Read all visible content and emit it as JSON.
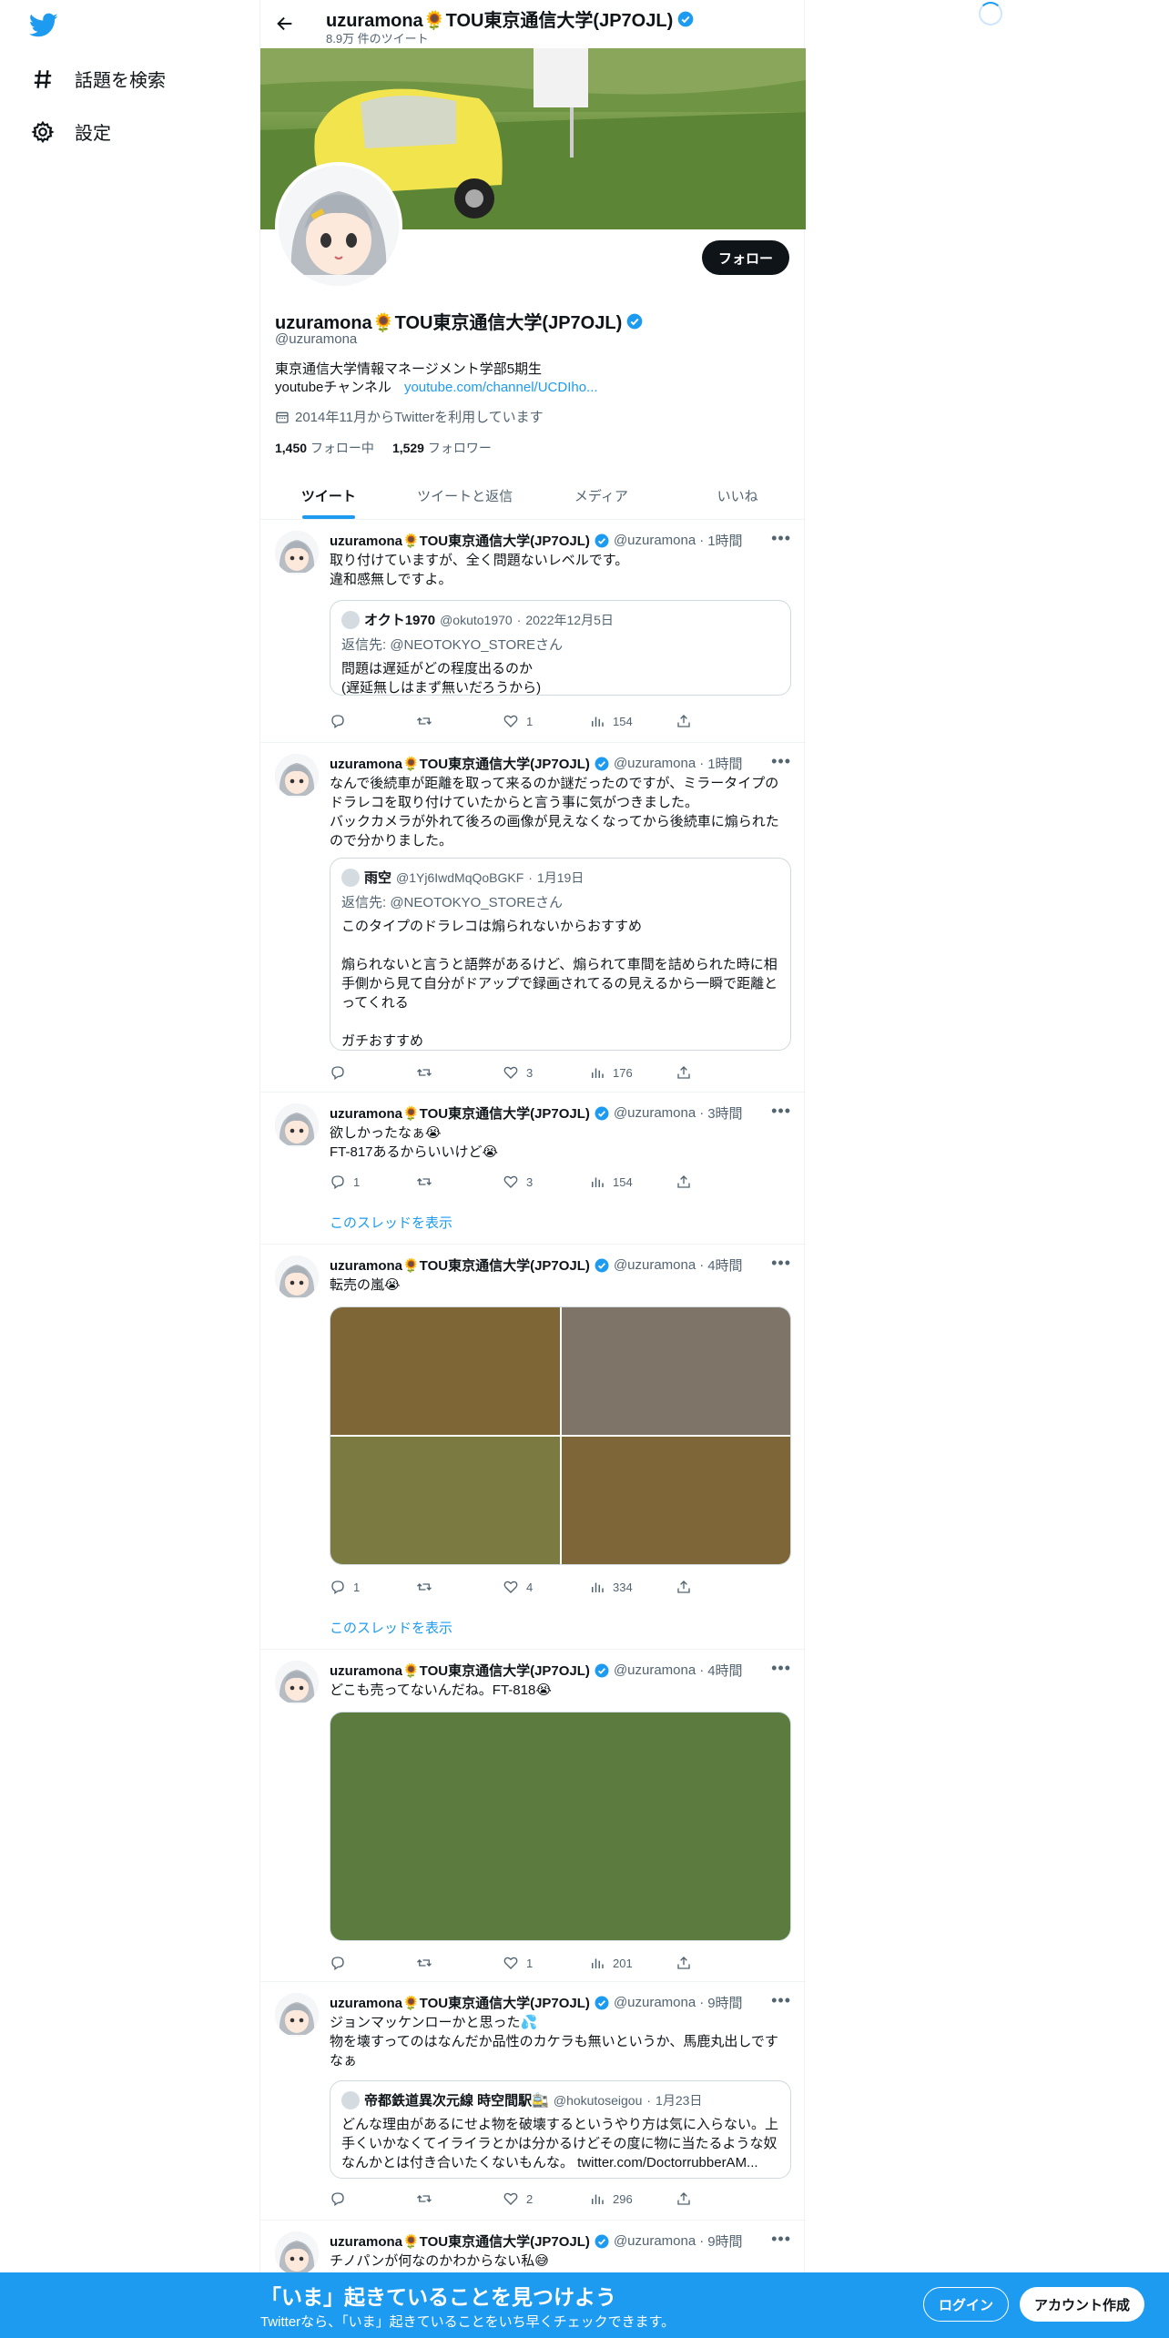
{
  "sidebar": {
    "items": [
      {
        "label": "話題を検索",
        "icon": "hashtag-icon"
      },
      {
        "label": "設定",
        "icon": "gear-icon"
      }
    ]
  },
  "header": {
    "name": "uzuramona🌻TOU東京通信大学(JP7OJL)",
    "tweet_count": "8.9万 件のツイート"
  },
  "profile": {
    "name": "uzuramona🌻TOU東京通信大学(JP7OJL)",
    "handle": "@uzuramona",
    "bio_line1": "東京通信大学情報マネージメント学部5期生",
    "bio_line2_prefix": "youtubeチャンネル",
    "bio_link": "youtube.com/channel/UCDIho...",
    "joined": "2014年11月からTwitterを利用しています",
    "following_count": "1,450",
    "following_label": "フォロー中",
    "followers_count": "1,529",
    "followers_label": "フォロワー",
    "follow_button": "フォロー"
  },
  "tabs": [
    "ツイート",
    "ツイートと返信",
    "メディア",
    "いいね"
  ],
  "tweets": [
    {
      "name": "uzuramona🌻TOU東京通信大学(JP7OJL)",
      "handle": "@uzuramona",
      "time": "1時間",
      "text": "取り付けていますが、全く問題ないレベルです。\n違和感無しですよ。",
      "quote": {
        "name": "オクト1970",
        "handle": "@okuto1970",
        "date": "2022年12月5日",
        "reply_to": "返信先: @NEOTOKYO_STOREさん",
        "text": "問題は遅延がどの程度出るのか\n(遅延無しはまず無いだろうから)"
      },
      "replies": "",
      "retweets": "",
      "likes": "1",
      "views": "154"
    },
    {
      "name": "uzuramona🌻TOU東京通信大学(JP7OJL)",
      "handle": "@uzuramona",
      "time": "1時間",
      "text": "なんで後続車が距離を取って来るのか謎だったのですが、ミラータイプのドラレコを取り付けていたからと言う事に気がつきました。\nバックカメラが外れて後ろの画像が見えなくなってから後続車に煽られたので分かりました。",
      "quote": {
        "name": "雨空",
        "handle": "@1Yj6IwdMqQoBGKF",
        "date": "1月19日",
        "reply_to": "返信先: @NEOTOKYO_STOREさん",
        "text": "このタイプのドラレコは煽られないからおすすめ\n\n煽られないと言うと語弊があるけど、煽られて車間を詰められた時に相手側から見て自分がドアップで録画されてるの見えるから一瞬で距離とってくれる\n\nガチおすすめ"
      },
      "replies": "",
      "retweets": "",
      "likes": "3",
      "views": "176"
    },
    {
      "name": "uzuramona🌻TOU東京通信大学(JP7OJL)",
      "handle": "@uzuramona",
      "time": "3時間",
      "text": "欲しかったなぁ😭\nFT-817あるからいいけど😭",
      "replies": "1",
      "retweets": "",
      "likes": "3",
      "views": "154",
      "thread_link": "このスレッドを表示"
    },
    {
      "name": "uzuramona🌻TOU東京通信大学(JP7OJL)",
      "handle": "@uzuramona",
      "time": "4時間",
      "text": "転売の嵐😭",
      "media_colors": [
        "#7f6636",
        "#7f7468",
        "#7b7a40",
        "#7e6638"
      ],
      "replies": "1",
      "retweets": "",
      "likes": "4",
      "views": "334",
      "thread_link": "このスレッドを表示"
    },
    {
      "name": "uzuramona🌻TOU東京通信大学(JP7OJL)",
      "handle": "@uzuramona",
      "time": "4時間",
      "text": "どこも売ってないんだね。FT-818😭",
      "media_color": "#5b7c3e",
      "replies": "",
      "retweets": "",
      "likes": "1",
      "views": "201"
    },
    {
      "name": "uzuramona🌻TOU東京通信大学(JP7OJL)",
      "handle": "@uzuramona",
      "time": "9時間",
      "text": "ジョンマッケンローかと思った💦\n物を壊すってのはなんだか品性のカケラも無いというか、馬鹿丸出しですなぁ",
      "quote": {
        "name": "帝都鉄道異次元線 時空間駅🚉",
        "handle": "@hokutoseigou",
        "date": "1月23日",
        "reply_to": "",
        "text": "どんな理由があるにせよ物を破壊するというやり方は気に入らない。上手くいかなくてイライラとかは分かるけどその度に物に当たるような奴なんかとは付き合いたくないもんな。 twitter.com/DoctorrubberAM..."
      },
      "replies": "",
      "retweets": "",
      "likes": "2",
      "views": "296"
    },
    {
      "name": "uzuramona🌻TOU東京通信大学(JP7OJL)",
      "handle": "@uzuramona",
      "time": "9時間",
      "text": "チノパンが何なのかわからない私😅"
    }
  ],
  "bottom_bar": {
    "title": "「いま」起きていることを見つけよう",
    "subtitle": "Twitterなら、「いま」起きていることをいち早くチェックできます。",
    "login": "ログイン",
    "signup": "アカウント作成"
  },
  "colors": {
    "accent": "#1d9bf0",
    "text": "#0f1419",
    "secondary": "#536471",
    "verified": "#1d9bf0"
  }
}
